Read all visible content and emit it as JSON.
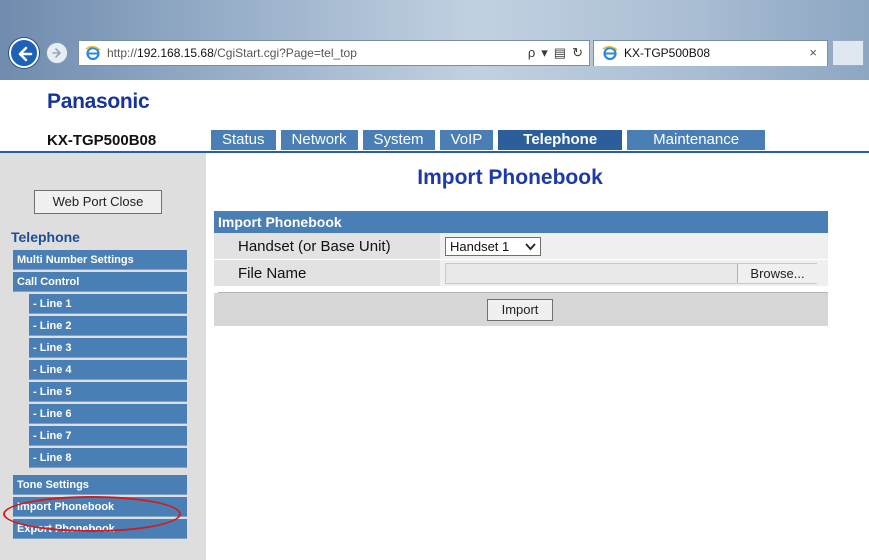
{
  "browser": {
    "url_prefix": "http://",
    "url_host": "192.168.15.68",
    "url_path": "/CgiStart.cgi?Page=tel_top",
    "tab_title": "KX-TGP500B08",
    "tab_close": "×",
    "addr_search": "ρ",
    "addr_dropdown": "▾",
    "addr_compat": "▤",
    "addr_refresh": "↻"
  },
  "brand": {
    "logo": "Panasonic",
    "model": "KX-TGP500B08"
  },
  "nav": {
    "tabs": [
      "Status",
      "Network",
      "System",
      "VoIP",
      "Telephone",
      "Maintenance"
    ],
    "active": "Telephone"
  },
  "sidebar": {
    "port_close_label": "Web Port Close",
    "section_title": "Telephone",
    "items": [
      "Multi Number Settings",
      "Call Control",
      "- Line 1",
      "- Line 2",
      "- Line 3",
      "- Line 4",
      "- Line 5",
      "- Line 6",
      "- Line 7",
      "- Line 8",
      "Tone Settings",
      "Import Phonebook",
      "Export Phonebook"
    ],
    "highlighted": "Import Phonebook",
    "highlight_color": "#d41a1a"
  },
  "main": {
    "title": "Import Phonebook",
    "panel_title": "Import Phonebook",
    "handset_label": "Handset (or Base Unit)",
    "handset_value": "Handset 1",
    "file_label": "File Name",
    "browse_label": "Browse...",
    "import_label": "Import"
  },
  "colors": {
    "accent": "#4a7fb5",
    "title": "#1e3aa8",
    "logo": "#17349b"
  }
}
